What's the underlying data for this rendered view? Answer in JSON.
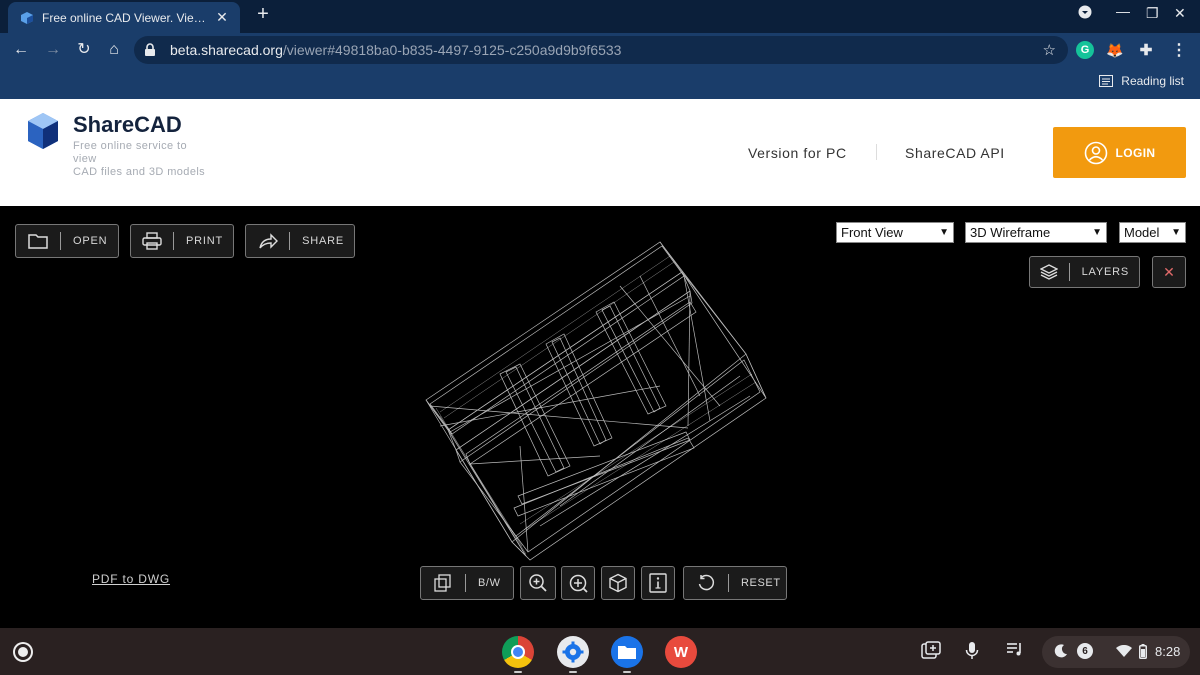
{
  "browser": {
    "tab_title": "Free online CAD Viewer. View Au",
    "tab_close": "✕",
    "new_tab": "+",
    "url_host": "beta.sharecad.org",
    "url_path": "/viewer#49818ba0-b835-4497-9125-c250a9d9b9f6533",
    "reading_list": "Reading list",
    "nav": {
      "back": "←",
      "forward": "→",
      "reload": "↻",
      "home": "⌂"
    },
    "window_controls": {
      "minimize": "—",
      "restore": "❐",
      "close": "✕"
    },
    "extensions": [
      {
        "name": "grammarly-icon",
        "glyph": "G",
        "color": "#15c39a"
      },
      {
        "name": "metamask-icon",
        "glyph": "🦊",
        "color": "#f6851b"
      },
      {
        "name": "extensions-puzzle-icon",
        "glyph": "✚",
        "color": "#e8eaed"
      }
    ],
    "menu_glyph": "⋮"
  },
  "site": {
    "brand": "ShareCAD",
    "tagline_1": "Free online service to view",
    "tagline_2": "CAD files and 3D models",
    "nav_pc": "Version for PC",
    "nav_api": "ShareCAD API",
    "login": "LOGIN",
    "accent": "#f29a0f"
  },
  "viewer": {
    "open": "OPEN",
    "print": "PRINT",
    "share": "SHARE",
    "view_select": "Front View",
    "render_select": "3D Wireframe",
    "space_select": "Model",
    "layers": "LAYERS",
    "close": "✕",
    "pdf_link": "PDF to DWG",
    "bw": "B/W",
    "reset": "RESET"
  },
  "shelf": {
    "time": "8:28",
    "notifications": "6",
    "apps": [
      "chrome-icon",
      "settings-icon",
      "files-icon",
      "wps-office-icon"
    ]
  }
}
